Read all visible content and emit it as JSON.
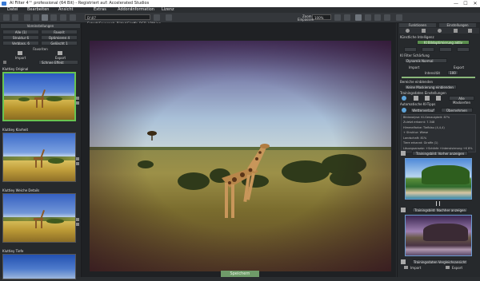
{
  "window": {
    "title": "AI Filter 4™ professional (64 Bit) - Registriert auf: Accelerated Studios",
    "minimize": "—",
    "maximize": "☐",
    "close": "✕"
  },
  "menu": [
    "Datei",
    "Bearbeiten",
    "Ansicht",
    "Extras",
    "Addons",
    "Information",
    "Lizenz"
  ],
  "toolbar": {
    "file_select": "D:\\07 Entsch\\Savannah_Bilder\\Giraffe_RGB_LOW.jpg",
    "zoom_label": "Zoom",
    "zoom_value": "100%",
    "fit_label": "Einpassen"
  },
  "left_panel": {
    "section_title": "Voreinstellungen",
    "buttons": [
      {
        "label": "Alle (1)"
      },
      {
        "label": "Favorit"
      },
      {
        "label": "Struktur 6"
      },
      {
        "label": "Optimieren 4"
      },
      {
        "label": "Verblass. 6"
      },
      {
        "label": "Gelöscht 1"
      }
    ],
    "favorites_title": "Favoriten",
    "import_label": "Import",
    "export_label": "Export",
    "filter_select": "Schnee Effekt",
    "presets": [
      {
        "label": "Kluttiey Original"
      },
      {
        "label": "Kluttiey Klarheit"
      },
      {
        "label": "Kluttiey Weiche Details"
      },
      {
        "label": "Kluttiey Tiefe"
      }
    ]
  },
  "center": {
    "save_label": "Speichern"
  },
  "right_panel": {
    "tabs": [
      "Funktionen",
      "Einstellungen"
    ],
    "title": "Künstliche Intelligenz",
    "ai_button": "KI Bildoptimierung aktiv",
    "filter_select_label": "KI Filter Schärfung",
    "filter_select_value": "Dynamik Normal",
    "import_label": "Import",
    "export_label": "Export",
    "strength_label": "Intensität",
    "strength_value": "100",
    "compare_label": "Bereiche einblenden",
    "compare_value": "Keine Maskierung einblenden",
    "tp_label": "Trainingsdaten Einstellungen",
    "tp_button": "Alle Maskierten",
    "auto_label": "Automatische KI-Tipps",
    "auto_btn1": "Wetterverlauf",
    "auto_btn2": "Übernehmen",
    "info_lines": [
      "Bildanalyse: KI-Genauigkeit: 87%",
      "Zuletzt erkannt: 7.348",
      "Himmelfarbe: Tiefblau (4,4,4)",
      "+ Struktur: Wiese",
      "Landschaft: 81%",
      "Tiere erkannt: Giraffe (1)",
      "Lösungsansatz: +Schärfe +Intensivierung +K 8%"
    ],
    "panel_btn1": "Trainingsbild: Vorher anzeigen",
    "panel_btn2": "Trainingsbild: Nachher anzeigen",
    "panel_btn3": "Trainingsdaten Vergleichsansicht",
    "bottom_import": "Import",
    "bottom_export": "Export"
  },
  "colors": {
    "accent_green": "#67c451",
    "save_green": "#6f9b69",
    "panel_bg": "#26292c",
    "canvas_bg": "#1f2124"
  }
}
